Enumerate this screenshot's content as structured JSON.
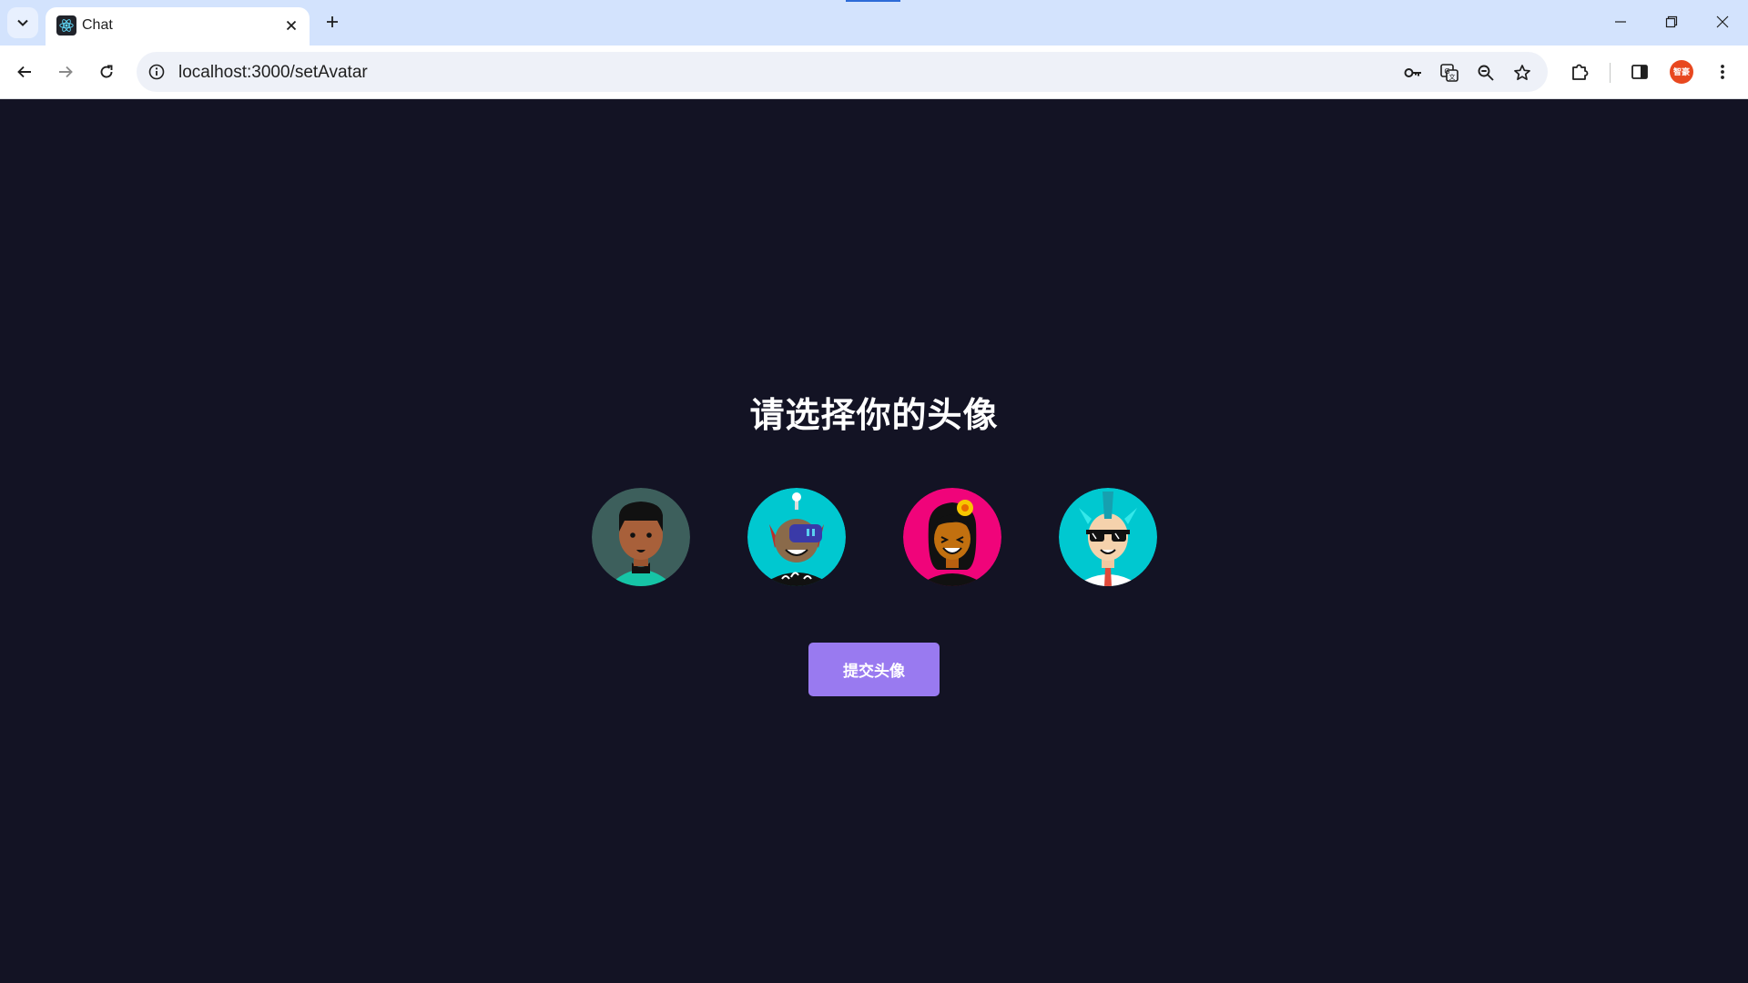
{
  "browser": {
    "tab_title": "Chat",
    "url": "localhost:3000/setAvatar",
    "profile_label": "智豪"
  },
  "page": {
    "title": "请选择你的头像",
    "submit_label": "提交头像",
    "avatars": [
      {
        "name": "avatar-1",
        "background": "#3d5f5c"
      },
      {
        "name": "avatar-2",
        "background": "#00c8d0"
      },
      {
        "name": "avatar-3",
        "background": "#f0047a"
      },
      {
        "name": "avatar-4",
        "background": "#00c8d0"
      }
    ]
  },
  "colors": {
    "page_background": "#131324",
    "accent": "#997af0",
    "tabstrip": "#d3e3fd"
  },
  "icons": [
    "tab-search-icon",
    "react-icon",
    "close-icon",
    "plus-icon",
    "minimize-icon",
    "restore-icon",
    "back-icon",
    "forward-icon",
    "reload-icon",
    "info-icon",
    "key-icon",
    "translate-icon",
    "zoom-icon",
    "star-icon",
    "extensions-icon",
    "sidepanel-icon",
    "menu-icon"
  ]
}
